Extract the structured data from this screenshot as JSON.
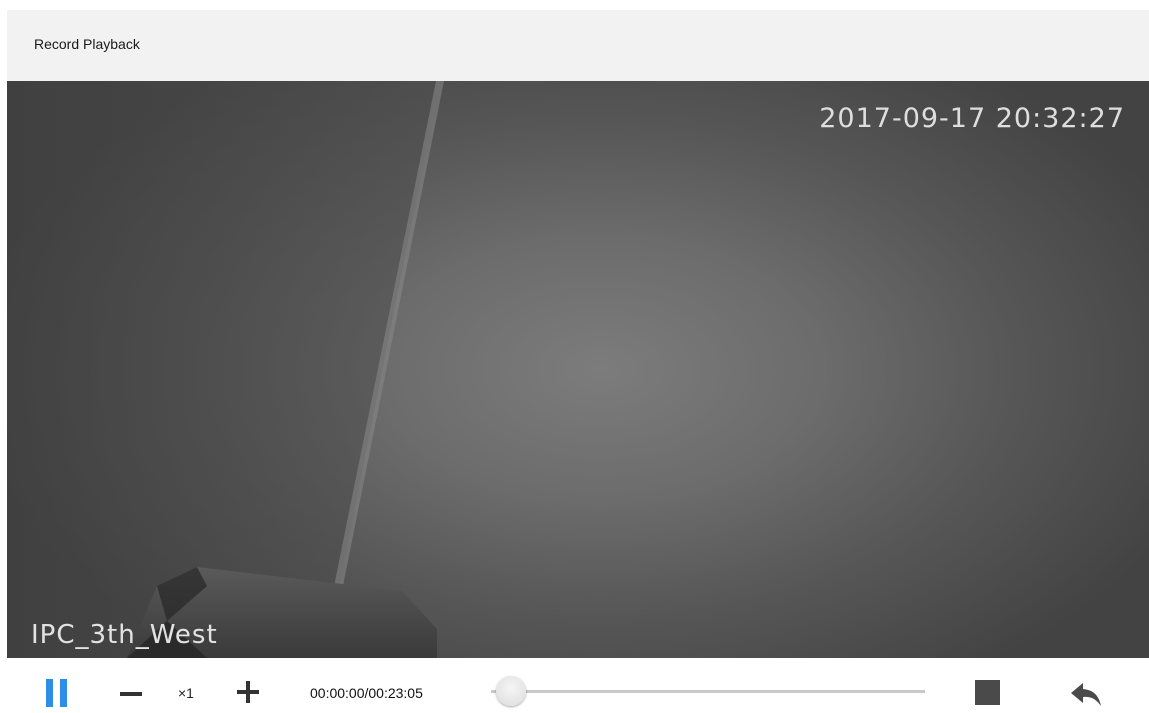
{
  "window": {
    "title": "Record Playback"
  },
  "video": {
    "osd_timestamp": "2017-09-17 20:32:27",
    "osd_camera_name": "IPC_3th_West"
  },
  "controls": {
    "pause_icon": "pause-icon",
    "slow_icon": "minus-icon",
    "speed_label": "×1",
    "fast_icon": "plus-icon",
    "timecode": "00:00:00/00:23:05",
    "progress_fraction": 0.0,
    "stop_icon": "stop-icon",
    "back_icon": "reply-arrow-icon",
    "accent_color": "#2d8ee6"
  }
}
